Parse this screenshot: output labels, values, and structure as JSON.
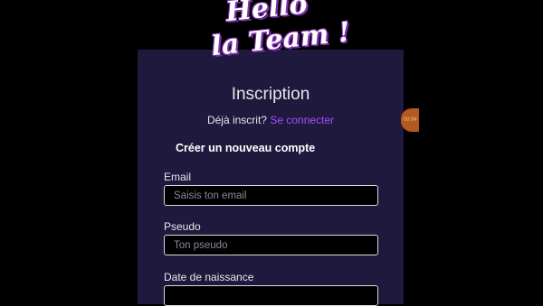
{
  "overlay": {
    "line1": "Hello",
    "line2": "la Team !"
  },
  "form": {
    "title": "Inscription",
    "login_prompt": "Déjà inscrit?",
    "login_link": "Se connecter",
    "subtitle": "Créer un nouveau compte",
    "email": {
      "label": "Email",
      "placeholder": "Saisis ton email",
      "value": ""
    },
    "pseudo": {
      "label": "Pseudo",
      "placeholder": "Ton pseudo",
      "value": ""
    },
    "birthdate": {
      "label": "Date de naissance",
      "placeholder": "",
      "value": ""
    }
  },
  "timer": {
    "text": "00:04"
  },
  "colors": {
    "background": "#000000",
    "panel": "#1f1a3d",
    "link": "#a64dff",
    "overlay_outline": "#7b2fa8",
    "timer_badge": "#b25a1e"
  }
}
